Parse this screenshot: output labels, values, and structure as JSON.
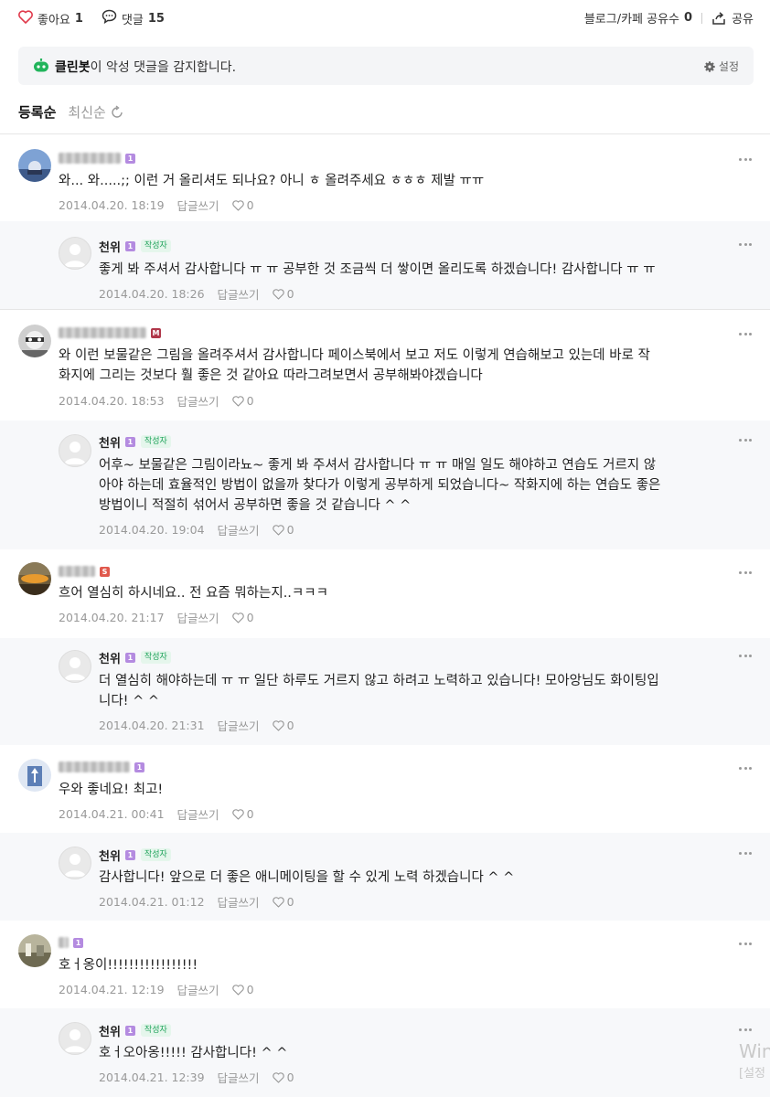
{
  "topbar": {
    "like_label": "좋아요",
    "like_count": "1",
    "comment_label": "댓글",
    "comment_count": "15",
    "share_count_label": "블로그/카페 공유수",
    "share_count": "0",
    "share_label": "공유"
  },
  "cleanbot": {
    "name": "클린봇",
    "message": "이 악성 댓글을 감지합니다.",
    "settings_label": "설정"
  },
  "sort": {
    "registered": "등록순",
    "latest": "최신순"
  },
  "reply_label": "답글쓰기",
  "author_badge": "작성자",
  "author_nick": "천위",
  "comments": [
    {
      "level": "1",
      "text": "와... 와.....;; 이런 거 올리셔도 되나요? 아니 ㅎ 올려주세요 ㅎㅎㅎ 제발 ㅠㅠ",
      "date": "2014.04.20. 18:19",
      "likes": "0"
    },
    {
      "level": "1",
      "text": "좋게 봐 주셔서 감사합니다 ㅠ ㅠ 공부한 것 조금씩 더 쌓이면 올리도록 하겠습니다! 감사합니다 ㅠ ㅠ",
      "date": "2014.04.20. 18:26",
      "likes": "0"
    },
    {
      "level": "M",
      "text_line1": "와 이런 보물같은 그림을 올려주셔서 감사합니다 페이스북에서 보고 저도 이렇게 연습해보고 있는데 바로 작",
      "text_line2": "화지에 그리는 것보다 훨 좋은 것 같아요 따라그려보면서 공부해봐야겠습니다",
      "date": "2014.04.20. 18:53",
      "likes": "0"
    },
    {
      "level": "1",
      "text_line1": "어후~ 보물같은 그림이라뇨~ 좋게 봐 주셔서 감사합니다 ㅠ ㅠ 매일 일도 해야하고 연습도 거르지 않",
      "text_line2": "아야 하는데 효율적인 방법이 없을까 찾다가 이렇게 공부하게 되었습니다~ 작화지에 하는 연습도 좋은",
      "text_line3": "방법이니 적절히 섞어서 공부하면 좋을 것 같습니다 ^ ^",
      "date": "2014.04.20. 19:04",
      "likes": "0"
    },
    {
      "level": "S",
      "text": "흐어 열심히 하시네요.. 전 요즘 뭐하는지..ㅋㅋㅋ",
      "date": "2014.04.20. 21:17",
      "likes": "0"
    },
    {
      "level": "1",
      "text_line1": "더 열심히 해야하는데 ㅠ ㅠ 일단 하루도 거르지 않고 하려고 노력하고 있습니다! 모아앙님도 화이팅입",
      "text_line2": "니다! ^ ^",
      "date": "2014.04.20. 21:31",
      "likes": "0"
    },
    {
      "level": "1",
      "text": "우와 좋네요! 최고!",
      "date": "2014.04.21. 00:41",
      "likes": "0"
    },
    {
      "level": "1",
      "text": "감사합니다! 앞으로 더 좋은 애니메이팅을 할 수 있게 노력 하겠습니다 ^ ^",
      "date": "2014.04.21. 01:12",
      "likes": "0"
    },
    {
      "level": "1",
      "text": "호ㅓ옹이!!!!!!!!!!!!!!!!!",
      "date": "2014.04.21. 12:19",
      "likes": "0"
    },
    {
      "level": "1",
      "text": "호ㅓ오아옹!!!!! 감사합니다! ^ ^",
      "date": "2014.04.21. 12:39",
      "likes": "0"
    }
  ],
  "watermark": {
    "line1": "Win",
    "line2": "[설정"
  },
  "colors": {
    "level_purple": "#b48be0",
    "level_m": "#b0374a",
    "level_s": "#e0584c",
    "cleanbot_green": "#21b45b",
    "like_heart": "#e0394b"
  }
}
